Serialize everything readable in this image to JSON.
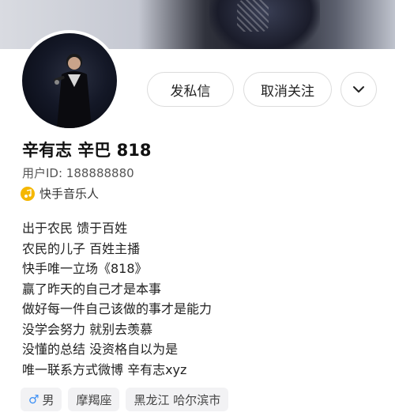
{
  "header": {
    "send_message_label": "发私信",
    "unfollow_label": "取消关注",
    "more_icon": "chevron-down-icon"
  },
  "profile": {
    "name": "辛有志 辛巴 818",
    "user_id": "用户ID: 188888880",
    "badge_icon": "music-note-icon",
    "badge_label": "快手音乐人",
    "badge_color": "#F5B700"
  },
  "bio": {
    "lines": [
      "出于农民 馈于百姓",
      "农民的儿子  百姓主播",
      "快手唯一立场《818》",
      "赢了昨天的自己才是本事",
      "做好每一件自己该做的事才是能力",
      "没学会努力  就别去羡慕",
      "没懂的总结 没资格自以为是",
      "唯一联系方式微博  辛有志xyz"
    ]
  },
  "tags": {
    "gender_icon": "male-icon",
    "gender_label": "男",
    "zodiac": "摩羯座",
    "location": "黑龙江 哈尔滨市"
  }
}
